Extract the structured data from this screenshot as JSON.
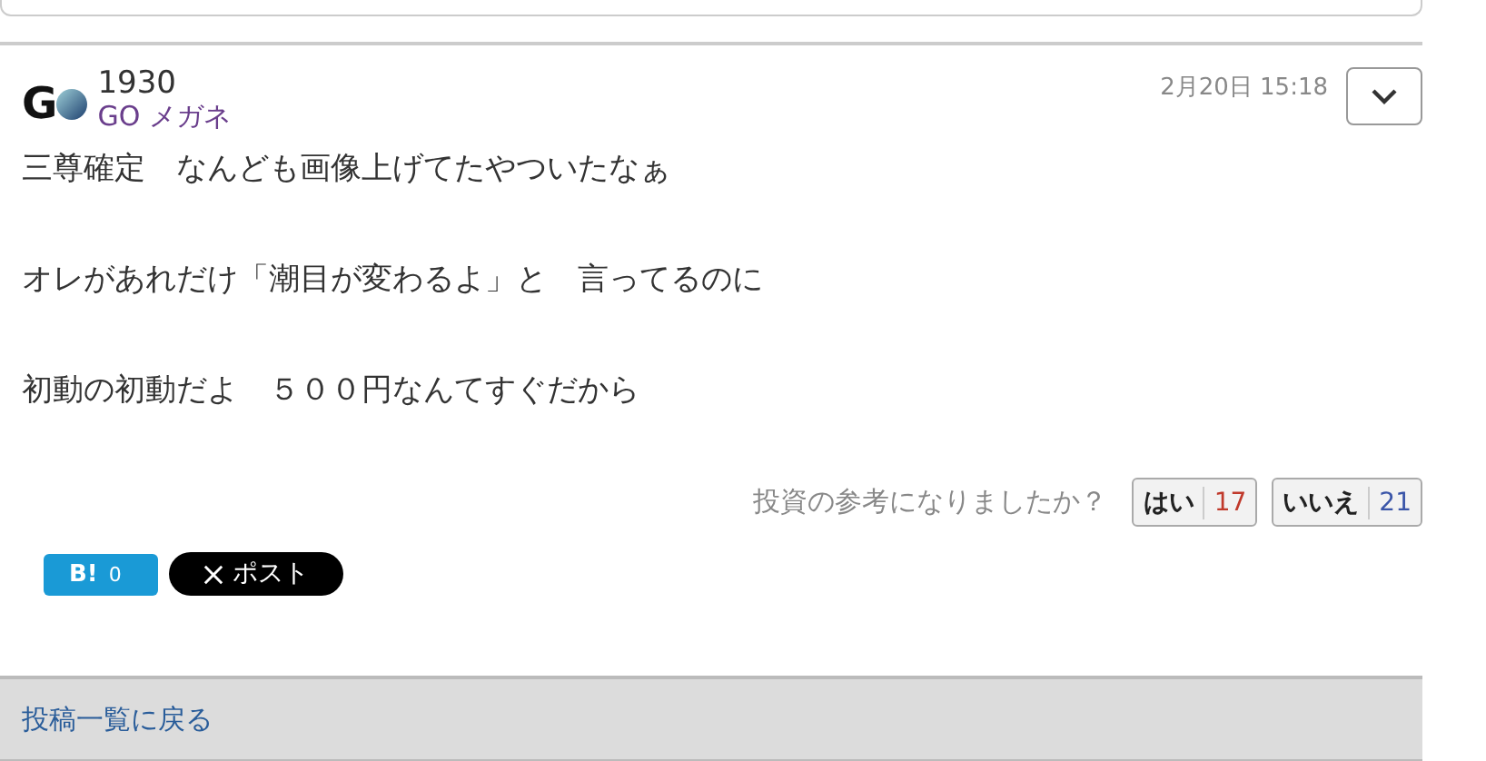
{
  "post": {
    "logo_letter": "G",
    "user_id": "1930",
    "user_name": "GO メガネ",
    "date": "2月20日 15:18",
    "lines": [
      "三尊確定　なんども画像上げてたやついたなぁ",
      "オレがあれだけ「潮目が変わるよ」と　言ってるのに",
      "初動の初動だよ　５００円なんてすぐだから"
    ],
    "vote_question": "投資の参考になりましたか？",
    "votes": [
      {
        "label": "はい",
        "count": "17",
        "color": "#c0392b"
      },
      {
        "label": "いいえ",
        "count": "21",
        "color": "#3a55a8"
      }
    ],
    "hatena": {
      "label": "B!",
      "count": "0"
    },
    "x_post": {
      "label": "ポスト"
    }
  },
  "footer": {
    "link": "投稿一覧に戻る"
  }
}
